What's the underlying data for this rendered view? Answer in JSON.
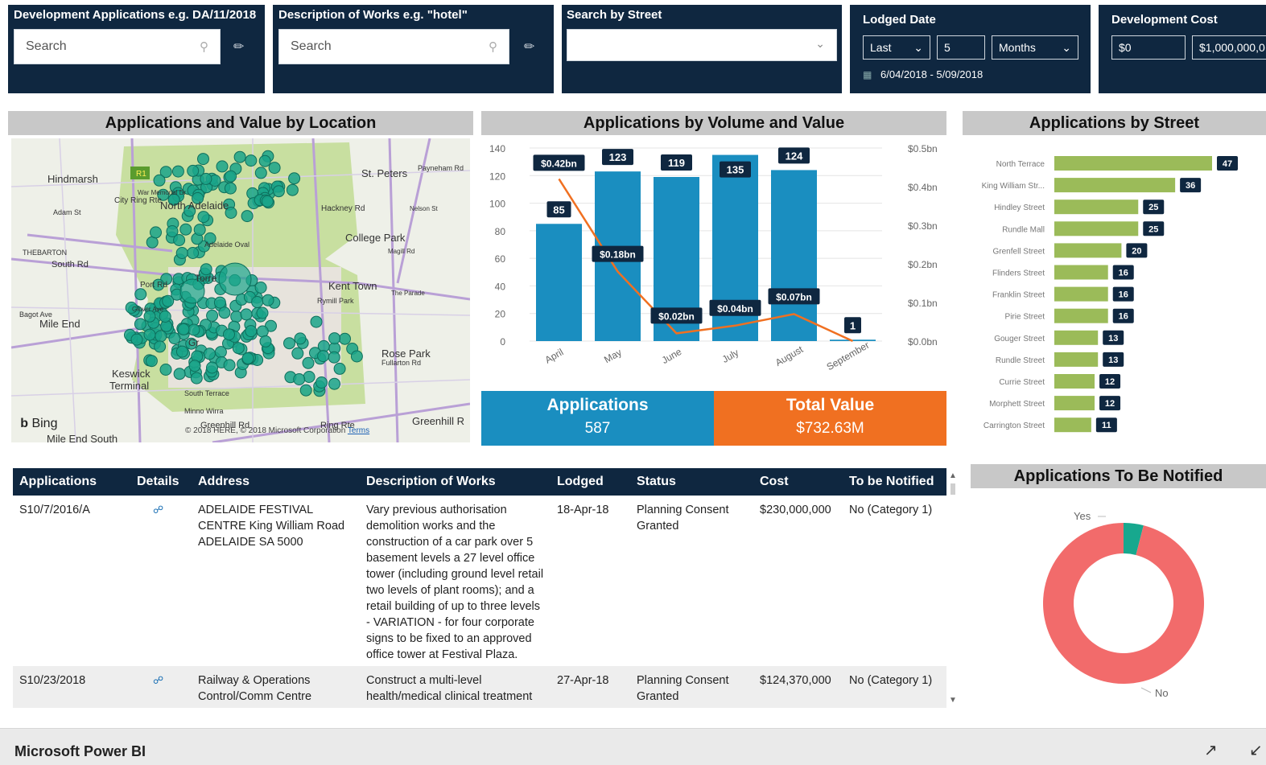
{
  "filters": {
    "dev_app": {
      "title": "Development Applications e.g. DA/11/2018",
      "placeholder": "Search"
    },
    "description": {
      "title": "Description of Works e.g. \"hotel\"",
      "placeholder": "Search"
    },
    "street": {
      "title": "Search by Street",
      "value": ""
    },
    "lodged": {
      "title": "Lodged Date",
      "period_type": "Last",
      "count": "5",
      "unit": "Months",
      "range": "6/04/2018 - 5/09/2018"
    },
    "cost": {
      "title": "Development Cost",
      "min": "$0",
      "max": "$1,000,000,0"
    }
  },
  "map": {
    "title": "Applications and Value by Location",
    "labels": [
      "Hindmarsh",
      "St. Peters",
      "North Adelaide",
      "College Park",
      "Magill Rd",
      "THEBARTON",
      "Adam St",
      "Kent Town",
      "The Parade",
      "Mile End",
      "Rose Park",
      "Keswick",
      "Terminal",
      "Greenhill R",
      "Mile End South",
      "City Ring Rte",
      "War Memorial Dr",
      "Port Rd",
      "South Rd",
      "Hackney Rd",
      "Payneham Rd",
      "Nelson St",
      "Fullarton Rd",
      "Bagot Ave",
      "Torre",
      "Adelaide Oval",
      "Gr",
      "South Terrace",
      "Minno Wirra",
      "Greenhill Rd",
      "Ring Rte",
      "Glover Ave",
      "Rymill Park"
    ],
    "badge": "R1",
    "bing": "Bing",
    "copyright": "© 2018 HERE, © 2018 Microsoft Corporation",
    "terms": "Terms",
    "colors": {
      "dot": "#1aa58a",
      "park": "#c8dfa0",
      "road": "#b9a0d6"
    }
  },
  "volume_chart": {
    "title": "Applications by Volume and Value",
    "chart_data": {
      "type": "bar",
      "categories": [
        "April",
        "May",
        "June",
        "July",
        "August",
        "September"
      ],
      "series": [
        {
          "values": [
            85,
            123,
            119,
            135,
            124,
            1
          ],
          "labels": [
            "85",
            "123",
            "119",
            "135",
            "124",
            "1"
          ]
        },
        {
          "values": [
            0.42,
            0.18,
            0.02,
            0.04,
            0.07,
            0.0
          ],
          "labels": [
            "$0.42bn",
            "$0.18bn",
            "$0.02bn",
            "$0.04bn",
            "$0.07bn",
            ""
          ]
        }
      ],
      "ylim": [
        0,
        140
      ],
      "y_ticks": [
        "0",
        "20",
        "40",
        "60",
        "80",
        "100",
        "120",
        "140"
      ],
      "y2lim": [
        0,
        0.5
      ],
      "y2_ticks": [
        "$0.0bn",
        "$0.1bn",
        "$0.2bn",
        "$0.3bn",
        "$0.4bn",
        "$0.5bn"
      ],
      "colors": {
        "bar": "#1a8ec0",
        "line": "#f07021",
        "label_bg": "#0f2740"
      }
    }
  },
  "kpis": {
    "applications": {
      "label": "Applications",
      "value": "587"
    },
    "total_value": {
      "label": "Total Value",
      "value": "$732.63M"
    }
  },
  "street_chart": {
    "title": "Applications by Street",
    "chart_data": {
      "type": "bar",
      "categories": [
        "North Terrace",
        "King William Str...",
        "Hindley Street",
        "Rundle Mall",
        "Grenfell Street",
        "Flinders Street",
        "Franklin Street",
        "Pirie Street",
        "Gouger Street",
        "Rundle Street",
        "Currie Street",
        "Morphett Street",
        "Carrington Street"
      ],
      "values": [
        47,
        36,
        25,
        25,
        20,
        16,
        16,
        16,
        13,
        13,
        12,
        12,
        11
      ],
      "xlim": [
        0,
        47
      ],
      "colors": {
        "bar": "#9bbb59",
        "label_bg": "#0f2740"
      }
    }
  },
  "table": {
    "headers": [
      "Applications",
      "Details",
      "Address",
      "Description of Works",
      "Lodged",
      "Status",
      "Cost",
      "To be Notified"
    ],
    "rows": [
      {
        "application": "S10/7/2016/A",
        "address": "ADELAIDE FESTIVAL CENTRE King William Road ADELAIDE SA 5000",
        "description": "Vary previous authorisation demolition works and the construction of a car park over 5 basement levels a 27 level office tower (including ground level retail two levels of plant rooms); and a retail building of up to three levels - VARIATION - for four corporate signs to be fixed to an approved office tower at Festival Plaza.",
        "lodged": "18-Apr-18",
        "status": "Planning Consent Granted",
        "cost": "$230,000,000",
        "notified": "No (Category 1)"
      },
      {
        "application": "S10/23/2018",
        "address": "Railway & Operations Control/Comm Centre",
        "description": "Construct a multi-level health/medical clinical treatment",
        "lodged": "27-Apr-18",
        "status": "Planning Consent Granted",
        "cost": "$124,370,000",
        "notified": "No (Category 1)"
      }
    ]
  },
  "donut": {
    "title": "Applications To Be Notified",
    "chart_data": {
      "type": "pie",
      "categories": [
        "Yes",
        "No"
      ],
      "values": [
        4,
        96
      ],
      "colors": [
        "#17a88e",
        "#f26b6b"
      ]
    }
  },
  "footer": {
    "app_name": "Microsoft Power BI"
  }
}
